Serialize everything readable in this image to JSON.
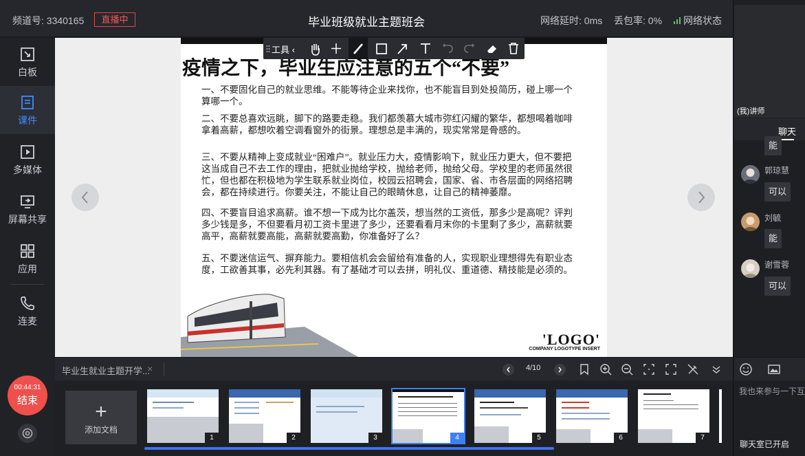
{
  "topbar": {
    "channel": "频道号: 3340165",
    "live_badge": "直播中",
    "title": "毕业班级就业主题班会",
    "latency": "网络延时: 0ms",
    "packet_loss": "丢包率: 0%",
    "network_state": "网络状态",
    "network_color": "#5cc36a"
  },
  "nav": {
    "items": [
      {
        "label": "白板",
        "icon": "whiteboard-icon"
      },
      {
        "label": "课件",
        "icon": "courseware-icon",
        "active": true
      },
      {
        "label": "多媒体",
        "icon": "media-icon"
      },
      {
        "label": "屏幕共享",
        "icon": "screen-share-icon"
      },
      {
        "label": "应用",
        "icon": "apps-icon"
      },
      {
        "label": "连麦",
        "icon": "phone-icon"
      }
    ],
    "timer": "00:44:31",
    "end_label": "结束"
  },
  "toolbar": {
    "tools_label": "工具"
  },
  "slide": {
    "title": "疫情之下，毕业生应注意的五个“不要”",
    "paragraphs": [
      "一、不要固化自己的就业思维。不能等待企业来找你，也不能盲目到处投简历，碰上哪一个算哪一个。",
      "二、不要总喜欢远眺，脚下的路要走稳。我们都羡慕大城市弥红闪耀的繁华，都想喝着咖啡拿着高薪，都想吹着空调看窗外的街景。理想总是丰满的，现实常常是骨感的。",
      "三、不要从精神上变成就业“困难户”。就业压力大，疫情影响下，就业压力更大，但不要把这当成自己不去工作的理由，把就业抛给学校，抛给老师，抛给父母。学校里的老师虽然很忙，但也都在积极地为学生联系就业岗位，校园云招聘会，国家、省、市各层面的网络招聘会，都在持续进行。你要关注，不能让自己的眼睛休息，让自己的精神萎靡。",
      "四、不要盲目追求高薪。谁不想一下成为比尔盖茨，想当然的工资低，那多少是高呢？评判多少钱是多，不但要看月初工资卡里进了多少，还要看看月末你的卡里剩了多少，高薪就要高平，高薪就要高能，高薪就要高勤，你准备好了么？",
      "五、不要迷信运气、摒弃能力。要相信机会会留给有准备的人，实现职业理想得先有职业态度，工欲善其事，必先利其器。有了基础才可以去拼，明礼仪、重道德、精技能是必须的。"
    ],
    "footer": "COMPANY LOGOTYPE INSERT",
    "logo": "'LOGO'"
  },
  "docbar": {
    "doc_name": "毕业生就业主题开学...",
    "close": "×",
    "page": "4/10"
  },
  "thumbs": {
    "add_label": "添加文档",
    "plus": "+",
    "items": [
      {
        "num": "1"
      },
      {
        "num": "2"
      },
      {
        "num": "3"
      },
      {
        "num": "4",
        "selected": true
      },
      {
        "num": "5"
      },
      {
        "num": "6"
      },
      {
        "num": "7"
      }
    ]
  },
  "right": {
    "video_label": "(我)讲师",
    "chat_tab": "聊天",
    "messages": [
      {
        "name": "",
        "text": "能"
      },
      {
        "name": "郭琼慧",
        "text": "可以"
      },
      {
        "name": "刘毓",
        "text": "能"
      },
      {
        "name": "谢雪蓉",
        "text": "可以"
      }
    ],
    "input_placeholder": "我也来参与一下互动",
    "chat_status": "聊天室已开启"
  }
}
